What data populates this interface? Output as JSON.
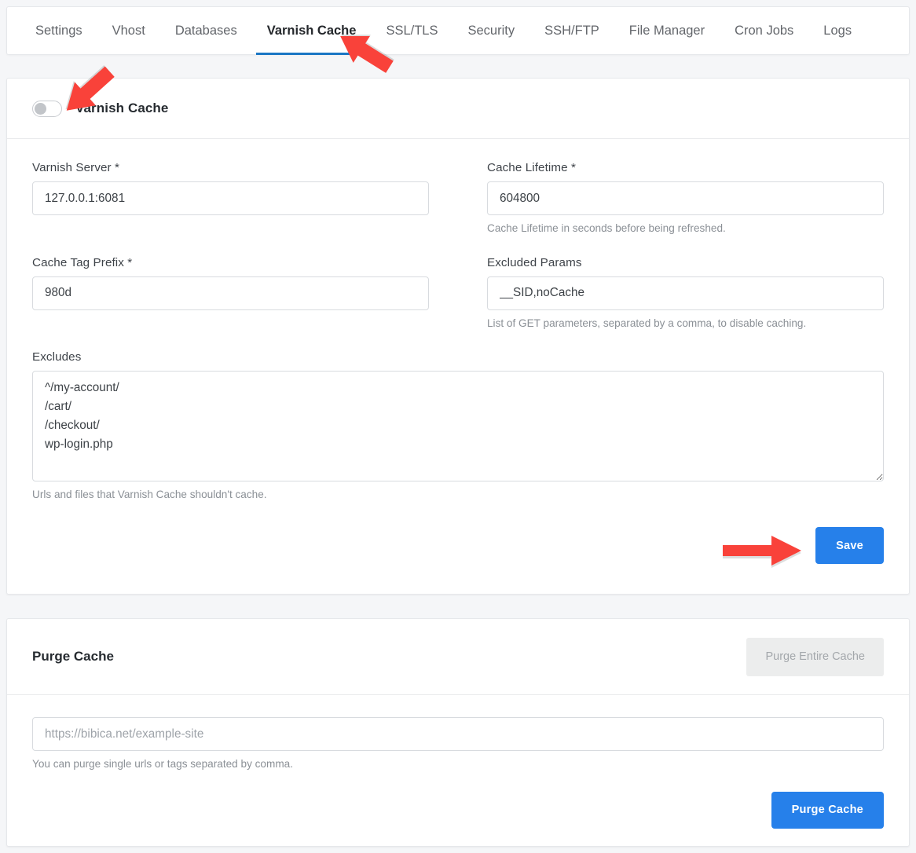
{
  "tabs": [
    {
      "label": "Settings",
      "active": false
    },
    {
      "label": "Vhost",
      "active": false
    },
    {
      "label": "Databases",
      "active": false
    },
    {
      "label": "Varnish Cache",
      "active": true
    },
    {
      "label": "SSL/TLS",
      "active": false
    },
    {
      "label": "Security",
      "active": false
    },
    {
      "label": "SSH/FTP",
      "active": false
    },
    {
      "label": "File Manager",
      "active": false
    },
    {
      "label": "Cron Jobs",
      "active": false
    },
    {
      "label": "Logs",
      "active": false
    }
  ],
  "settings_card": {
    "toggle_label": "Varnish Cache",
    "toggle_state": "off",
    "fields": {
      "varnish_server": {
        "label": "Varnish Server *",
        "value": "127.0.0.1:6081",
        "placeholder": "",
        "help": ""
      },
      "cache_lifetime": {
        "label": "Cache Lifetime *",
        "value": "604800",
        "placeholder": "",
        "help": "Cache Lifetime in seconds before being refreshed."
      },
      "cache_tag_prefix": {
        "label": "Cache Tag Prefix *",
        "value": "980d",
        "placeholder": "",
        "help": ""
      },
      "excluded_params": {
        "label": "Excluded Params",
        "value": "__SID,noCache",
        "placeholder": "",
        "help": "List of GET parameters, separated by a comma, to disable caching."
      },
      "excludes": {
        "label": "Excludes",
        "value": "^/my-account/\n/cart/\n/checkout/\nwp-login.php",
        "placeholder": "",
        "help": "Urls and files that Varnish Cache shouldn't cache."
      }
    },
    "save_label": "Save"
  },
  "purge_card": {
    "title": "Purge Cache",
    "purge_entire_label": "Purge Entire Cache",
    "url_input": {
      "value": "",
      "placeholder": "https://bibica.net/example-site",
      "help": "You can purge single urls or tags separated by comma."
    },
    "purge_label": "Purge Cache"
  },
  "annotations": {
    "arrow_color": "#f9423a",
    "arrows": [
      {
        "name": "arrow-to-toggle",
        "direction": "down-left"
      },
      {
        "name": "arrow-to-varnish-tab",
        "direction": "up-left"
      },
      {
        "name": "arrow-to-save-button",
        "direction": "right"
      }
    ]
  },
  "colors": {
    "accent_blue": "#2680ea",
    "tab_underline": "#1a76c4",
    "page_bg": "#f5f6f8",
    "card_bg": "#ffffff",
    "border": "#e6e8eb"
  }
}
